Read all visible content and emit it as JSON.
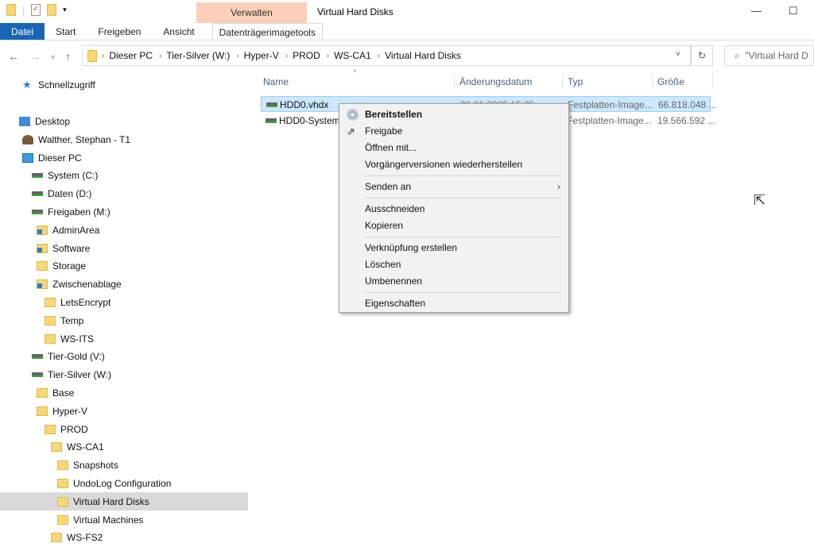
{
  "window": {
    "title": "Virtual Hard Disks",
    "manage_tab": "Verwalten"
  },
  "ribbon": {
    "tabs": [
      "Datei",
      "Start",
      "Freigeben",
      "Ansicht"
    ],
    "tool_tab": "Datenträgerimagetools"
  },
  "address": {
    "path": [
      "Dieser PC",
      "Tier-Silver (W:)",
      "Hyper-V",
      "PROD",
      "WS-CA1",
      "Virtual Hard Disks"
    ],
    "search_placeholder": "\"Virtual Hard D"
  },
  "sidebar": [
    {
      "label": "Schnellzugriff",
      "icon": "star",
      "level": 1
    },
    {
      "label": "",
      "icon": "",
      "level": 0
    },
    {
      "label": "Desktop",
      "icon": "desk",
      "level": 0
    },
    {
      "label": "Walther, Stephan - T1",
      "icon": "user",
      "level": 1
    },
    {
      "label": "Dieser PC",
      "icon": "pc",
      "level": 1
    },
    {
      "label": "System (C:)",
      "icon": "drive",
      "level": 2
    },
    {
      "label": "Daten (D:)",
      "icon": "drive",
      "level": 2
    },
    {
      "label": "Freigaben (M:)",
      "icon": "drive",
      "level": 2
    },
    {
      "label": "AdminArea",
      "icon": "share",
      "level": 3
    },
    {
      "label": "Software",
      "icon": "share",
      "level": 3
    },
    {
      "label": "Storage",
      "icon": "folder",
      "level": 3
    },
    {
      "label": "Zwischenablage",
      "icon": "share",
      "level": 3
    },
    {
      "label": "LetsEncrypt",
      "icon": "folder",
      "level": 4
    },
    {
      "label": "Temp",
      "icon": "folder",
      "level": 4
    },
    {
      "label": "WS-ITS",
      "icon": "folder",
      "level": 4
    },
    {
      "label": "Tier-Gold (V:)",
      "icon": "drive",
      "level": 2
    },
    {
      "label": "Tier-Silver (W:)",
      "icon": "drive",
      "level": 2
    },
    {
      "label": "Base",
      "icon": "folder",
      "level": 3
    },
    {
      "label": "Hyper-V",
      "icon": "folder",
      "level": 3
    },
    {
      "label": "PROD",
      "icon": "folder",
      "level": 4
    },
    {
      "label": "WS-CA1",
      "icon": "folder",
      "level": 5
    },
    {
      "label": "Snapshots",
      "icon": "folder",
      "level": 6
    },
    {
      "label": "UndoLog Configuration",
      "icon": "folder",
      "level": 6
    },
    {
      "label": "Virtual Hard Disks",
      "icon": "folder",
      "level": 6,
      "selected": true
    },
    {
      "label": "Virtual Machines",
      "icon": "folder",
      "level": 6
    },
    {
      "label": "WS-FS2",
      "icon": "folder",
      "level": 5
    }
  ],
  "columns": [
    "Name",
    "Änderungsdatum",
    "Typ",
    "Größe"
  ],
  "files": [
    {
      "name": "HDD0.vhdx",
      "date": "26.01.2025 15:25",
      "type": "Festplatten-Image...",
      "size": "66.818.048 ..."
    },
    {
      "name": "HDD0-System.vhdx",
      "date": "",
      "type": "Festplatten-Image...",
      "size": "19.566.592 ..."
    }
  ],
  "context_menu": [
    {
      "label": "Bereitstellen",
      "bold": true,
      "icon": "disc"
    },
    {
      "label": "Freigabe",
      "icon": "share"
    },
    {
      "label": "Öffnen mit..."
    },
    {
      "label": "Vorgängerversionen wiederherstellen"
    },
    {
      "sep": true
    },
    {
      "label": "Senden an",
      "submenu": true
    },
    {
      "sep": true
    },
    {
      "label": "Ausschneiden"
    },
    {
      "label": "Kopieren"
    },
    {
      "sep": true
    },
    {
      "label": "Verknüpfung erstellen"
    },
    {
      "label": "Löschen"
    },
    {
      "label": "Umbenennen"
    },
    {
      "sep": true
    },
    {
      "label": "Eigenschaften"
    }
  ]
}
